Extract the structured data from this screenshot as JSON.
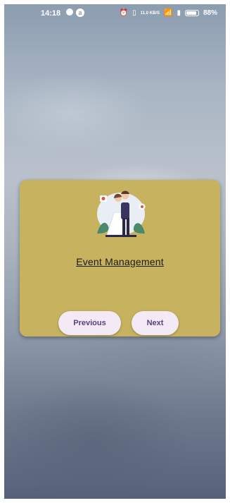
{
  "status_bar": {
    "time": "14:18",
    "net_speed": "11.0\nKB/S",
    "battery": "88%",
    "battery_level": 0.88
  },
  "card": {
    "title": "Event Management",
    "background": "#c7b35f",
    "illustration": "wedding-couple-icon"
  },
  "buttons": {
    "previous": "Previous",
    "next": "Next"
  },
  "colors": {
    "button_bg": "#f3eaf5",
    "button_text": "#5a3f7d"
  }
}
